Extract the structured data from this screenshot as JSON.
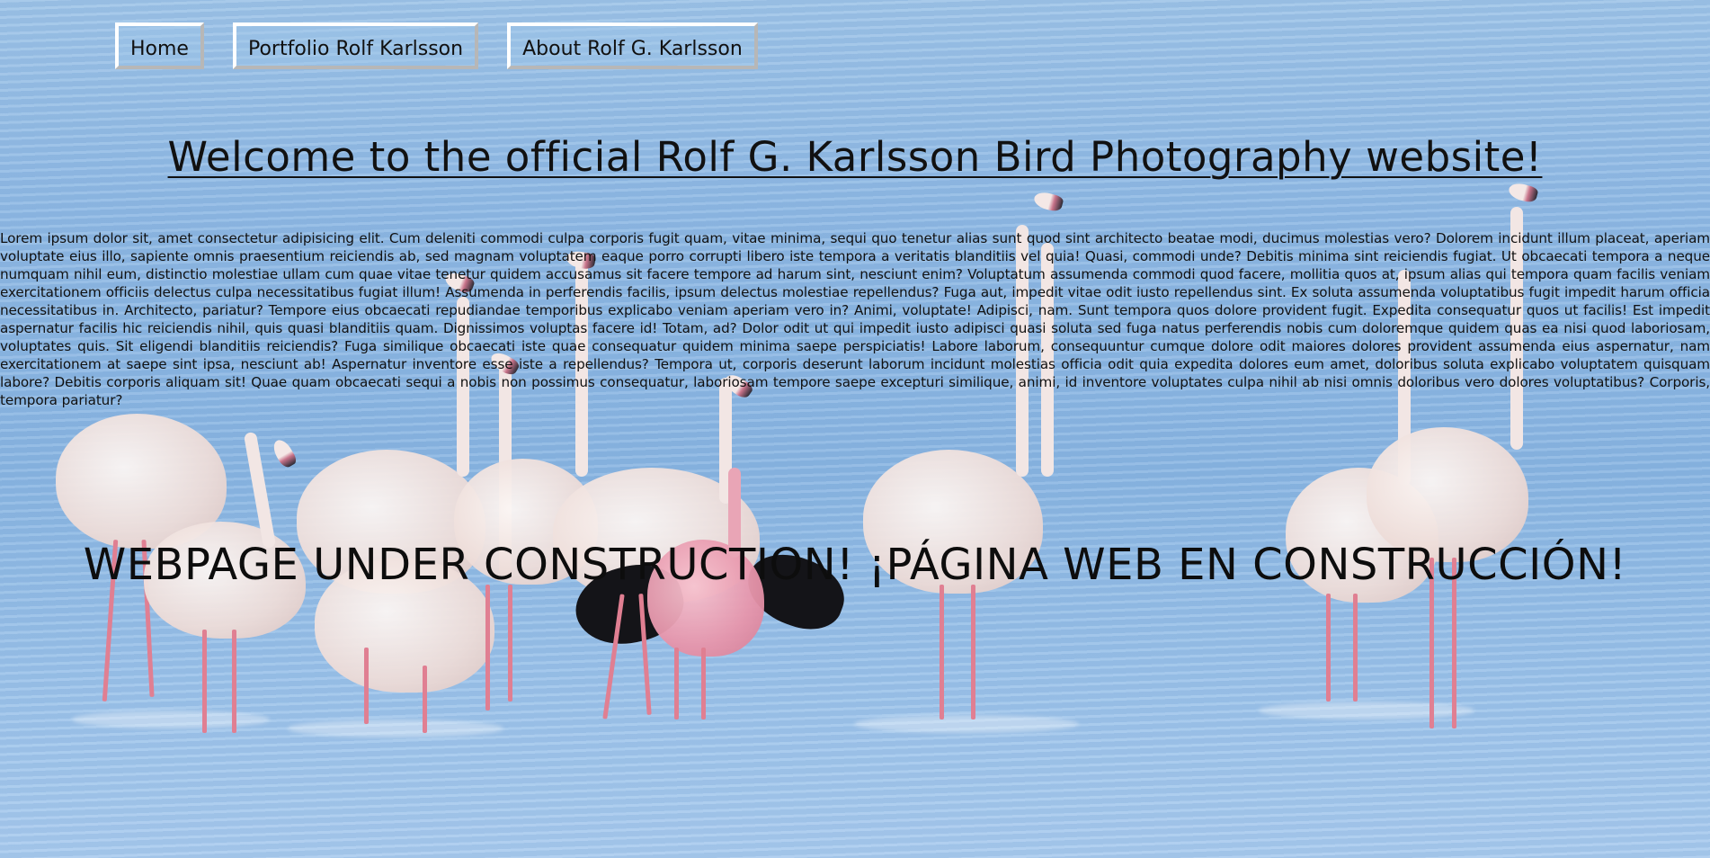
{
  "nav": {
    "items": [
      {
        "label": "Home"
      },
      {
        "label": "Portfolio Rolf Karlsson"
      },
      {
        "label": "About Rolf G. Karlsson"
      }
    ]
  },
  "main": {
    "title": "Welcome to the official Rolf G. Karlsson Bird Photography website!",
    "body_text": "Lorem ipsum dolor sit, amet consectetur adipisicing elit. Cum deleniti commodi culpa corporis fugit quam, vitae minima, sequi quo tenetur alias sunt quod sint architecto beatae modi, ducimus molestias vero? Dolorem incidunt illum placeat, aperiam voluptate eius illo, sapiente omnis praesentium reiciendis ab, sed magnam voluptatem eaque porro corrupti libero iste tempora a veritatis blanditiis vel quia! Quasi, commodi unde? Debitis minima sint reiciendis fugiat. Ut obcaecati tempora a neque numquam nihil eum, distinctio molestiae ullam cum quae vitae tenetur quidem accusamus sit facere tempore ad harum sint, nesciunt enim? Voluptatum assumenda commodi quod facere, mollitia quos at, ipsum alias qui tempora quam facilis veniam exercitationem officiis delectus culpa necessitatibus fugiat illum! Assumenda in perferendis facilis, ipsum delectus molestiae repellendus? Fuga aut, impedit vitae odit iusto repellendus sint. Ex soluta assumenda voluptatibus fugit impedit harum officia necessitatibus in. Architecto, pariatur? Tempore eius obcaecati repudiandae temporibus explicabo veniam aperiam vero in? Animi, voluptate! Adipisci, nam. Sunt tempora quos dolore provident fugit. Expedita consequatur quos ut facilis! Est impedit aspernatur facilis hic reiciendis nihil, quis quasi blanditiis quam. Dignissimos voluptas facere id! Totam, ad? Dolor odit ut qui impedit iusto adipisci quasi soluta sed fuga natus perferendis nobis cum doloremque quidem quas ea nisi quod laboriosam, voluptates quis. Sit eligendi blanditiis reiciendis? Fuga similique obcaecati iste quae consequatur quidem minima saepe perspiciatis! Labore laborum, consequuntur cumque dolore odit maiores dolores provident assumenda eius aspernatur, nam exercitationem at saepe sint ipsa, nesciunt ab! Aspernatur inventore esse iste a repellendus? Tempora ut, corporis deserunt laborum incidunt molestias officia odit quia expedita dolores eum amet, doloribus soluta explicabo voluptatem quisquam labore? Debitis corporis aliquam sit! Quae quam obcaecati sequi a nobis non possimus consequatur, laboriosam tempore saepe excepturi similique, animi, id inventore voluptates culpa nihil ab nisi omnis doloribus vero dolores voluptatibus? Corporis, tempora pariatur?",
    "notice": "WEBPAGE UNDER CONSTRUCTION! ¡PÁGINA WEB EN CONSTRUCCIÓN!"
  },
  "background": {
    "subject": "flamingos-in-water",
    "colors": {
      "water": "#8fb9e4",
      "plumage": "#f2e6e4",
      "legs": "#e07f92",
      "text": "#111111"
    }
  }
}
